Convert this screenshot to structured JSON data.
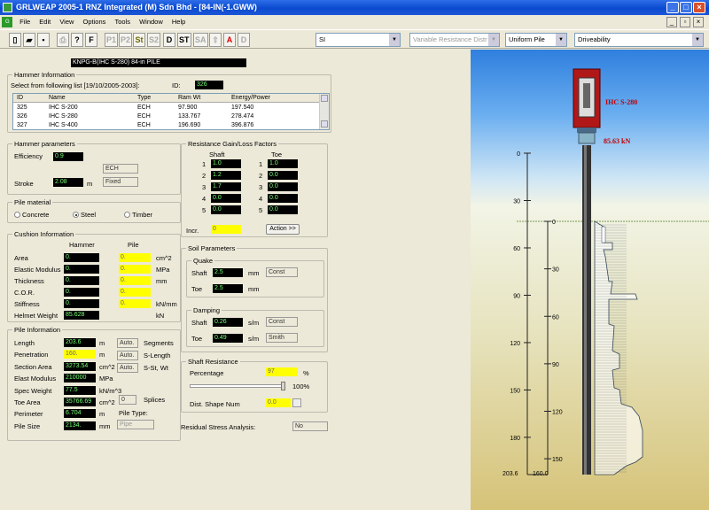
{
  "window": {
    "title": "GRLWEAP 2005-1 RNZ Integrated (M) Sdn Bhd  -  [84-IN(-1.GWW)"
  },
  "menu": [
    "File",
    "Edit",
    "View",
    "Options",
    "Tools",
    "Window",
    "Help"
  ],
  "toolbar": {
    "buttons": [
      "P1",
      "P2",
      "St",
      "S2",
      "D",
      "ST",
      "SA",
      "A",
      "D"
    ],
    "units": "SI",
    "resistance_dist": "Variable Resistance Distr",
    "pile_type": "Uniform Pile",
    "analysis": "Driveability"
  },
  "pile_title": "KNPG-B(IHC S-280) 84-in PILE",
  "hammer_info": {
    "label": "Hammer Information",
    "select_text": "Select from following list [19/10/2005-2003]:",
    "id_label": "ID:",
    "id_value": "326",
    "columns": [
      "ID",
      "Name",
      "Type",
      "Ram Wt",
      "Energy/Power"
    ],
    "rows": [
      [
        "325",
        "IHC S-200",
        "ECH",
        "97.900",
        "197.540"
      ],
      [
        "326",
        "IHC S-280",
        "ECH",
        "133.767",
        "278.474"
      ],
      [
        "327",
        "IHC S-400",
        "ECH",
        "196.690",
        "396.876"
      ]
    ]
  },
  "hammer_params": {
    "label": "Hammer parameters",
    "efficiency_label": "Efficiency",
    "efficiency": "0.9",
    "type": "ECH",
    "stroke_label": "Stroke",
    "stroke": "2.08",
    "stroke_unit": "m",
    "mode": "Fixed"
  },
  "pile_material": {
    "label": "Pile material",
    "options": [
      "Concrete",
      "Steel",
      "Timber"
    ],
    "selected": "Steel"
  },
  "cushion": {
    "label": "Cushion Information",
    "col_hammer": "Hammer",
    "col_pile": "Pile",
    "rows": [
      {
        "label": "Area",
        "h": "0.",
        "p": "0.",
        "unit": "cm^2"
      },
      {
        "label": "Elastic Modulus",
        "h": "0.",
        "p": "0.",
        "unit": "MPa"
      },
      {
        "label": "Thickness",
        "h": "0.",
        "p": "0.",
        "unit": "mm"
      },
      {
        "label": "C.O.R.",
        "h": "0.",
        "p": "0.",
        "unit": ""
      },
      {
        "label": "Stiffness",
        "h": "0.",
        "p": "0.",
        "unit": "kN/mm"
      }
    ],
    "helmet_label": "Helmet Weight",
    "helmet": "85.628",
    "helmet_unit": "kN"
  },
  "pile_info": {
    "label": "Pile Information",
    "rows": [
      {
        "label": "Length",
        "v": "203.6",
        "unit": "m"
      },
      {
        "label": "Penetration",
        "v": "160.",
        "unit": "m"
      },
      {
        "label": "Section Area",
        "v": "3273.54",
        "unit": "cm^2"
      },
      {
        "label": "Elast Modulus",
        "v": "210000",
        "unit": "MPa"
      },
      {
        "label": "Spec Weight",
        "v": "77.5",
        "unit": "kN/m^3"
      },
      {
        "label": "Toe Area",
        "v": "35766.69",
        "unit": "cm^2"
      },
      {
        "label": "Perimeter",
        "v": "6.704",
        "unit": "m"
      },
      {
        "label": "Pile Size",
        "v": "2134.",
        "unit": "mm"
      }
    ],
    "auto": "Auto.",
    "segments": "Segments",
    "slength": "S-Length",
    "sst": "S-St, Wt",
    "splices_val": "0",
    "splices": "Splices",
    "pile_type_label": "Pile Type:",
    "pile_type": "Pipe"
  },
  "gain_loss": {
    "label": "Resistance Gain/Loss Factors",
    "shaft": "Shaft",
    "toe": "Toe",
    "shaft_vals": [
      "1.0",
      "1.2",
      "1.7",
      "0.0",
      "0.0"
    ],
    "toe_vals": [
      "1.0",
      "0.0",
      "0.0",
      "0.0",
      "0.0"
    ],
    "incr_label": "Incr.",
    "incr": "0",
    "action": "Action >>"
  },
  "soil": {
    "label": "Soil Parameters",
    "quake": "Quake",
    "shaft": "Shaft",
    "toe": "Toe",
    "quake_shaft": "2.5",
    "quake_toe": "2.5",
    "mm": "mm",
    "const": "Const",
    "damping": "Damping",
    "damp_shaft": "0.26",
    "damp_toe": "0.49",
    "sm": "s/m",
    "smith": "Smith"
  },
  "shaft_res": {
    "label": "Shaft Resistance",
    "percentage_label": "Percentage",
    "percentage": "97",
    "pct": "%",
    "slider_max": "100%",
    "dist_label": "Dist. Shape Num",
    "dist": "0.0"
  },
  "residual": {
    "label": "Residual Stress Analysis:",
    "value": "No"
  },
  "graphic": {
    "hammer_label": "IHC S-280",
    "force_label": "85.63 kN",
    "left_ticks": [
      "0",
      "30",
      "60",
      "90",
      "120",
      "150",
      "180"
    ],
    "right_ticks": [
      "0",
      "30",
      "60",
      "90",
      "120",
      "150"
    ],
    "bottom_left": "203.6",
    "bottom_right": "160.0",
    "colors": {
      "hammer": "#b01818",
      "pile": "#333333",
      "text": "#c00000"
    }
  }
}
